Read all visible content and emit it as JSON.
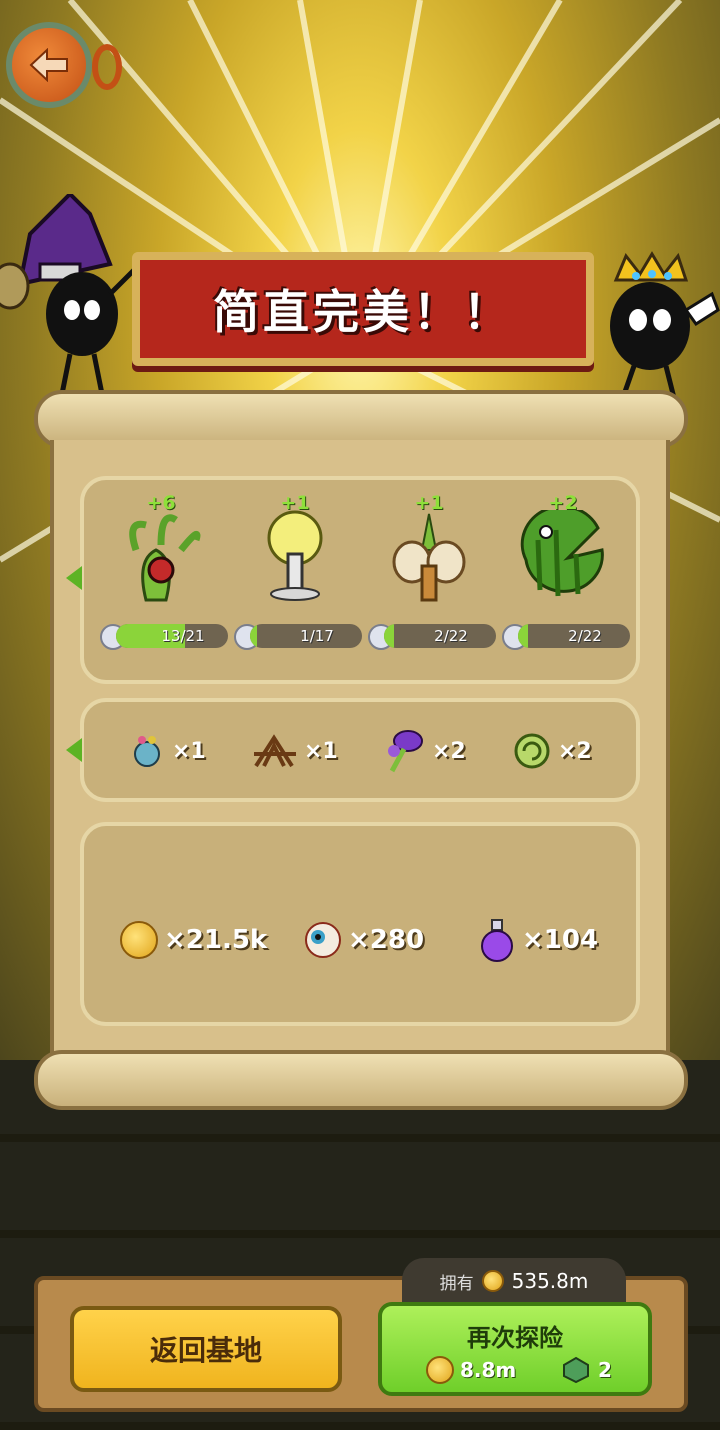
{
  "banner": {
    "title": "简直完美！！"
  },
  "plants": [
    {
      "plus": "+6",
      "progress_text": "13/21",
      "progress": 0.62,
      "icon": "medusa-plant-icon"
    },
    {
      "plus": "+1",
      "progress_text": "1/17",
      "progress": 0.06,
      "icon": "broccoli-flower-icon"
    },
    {
      "plus": "+1",
      "progress_text": "2/22",
      "progress": 0.09,
      "icon": "seed-pod-plant-icon"
    },
    {
      "plus": "+2",
      "progress_text": "2/22",
      "progress": 0.09,
      "icon": "watermelon-chomper-icon"
    }
  ],
  "materials": [
    {
      "icon": "blue-snail-material-icon",
      "count": "×1"
    },
    {
      "icon": "brown-roots-material-icon",
      "count": "×1"
    },
    {
      "icon": "purple-mushroom-material-icon",
      "count": "×2"
    },
    {
      "icon": "green-spiral-material-icon",
      "count": "×2"
    }
  ],
  "resources": [
    {
      "icon": "gold-coin-icon",
      "count": "×21.5k"
    },
    {
      "icon": "eyeball-icon",
      "count": "×280"
    },
    {
      "icon": "purple-potion-icon",
      "count": "×104"
    }
  ],
  "footer": {
    "home_label": "返回基地",
    "owned_label": "拥有",
    "owned_value": "535.8m",
    "again_label": "再次探险",
    "again_cost": "8.8m",
    "again_gem_cost": "2"
  },
  "colors": {
    "banner": "#b5271c",
    "accent_green": "#8bd43a",
    "gold": "#f0b41e"
  }
}
